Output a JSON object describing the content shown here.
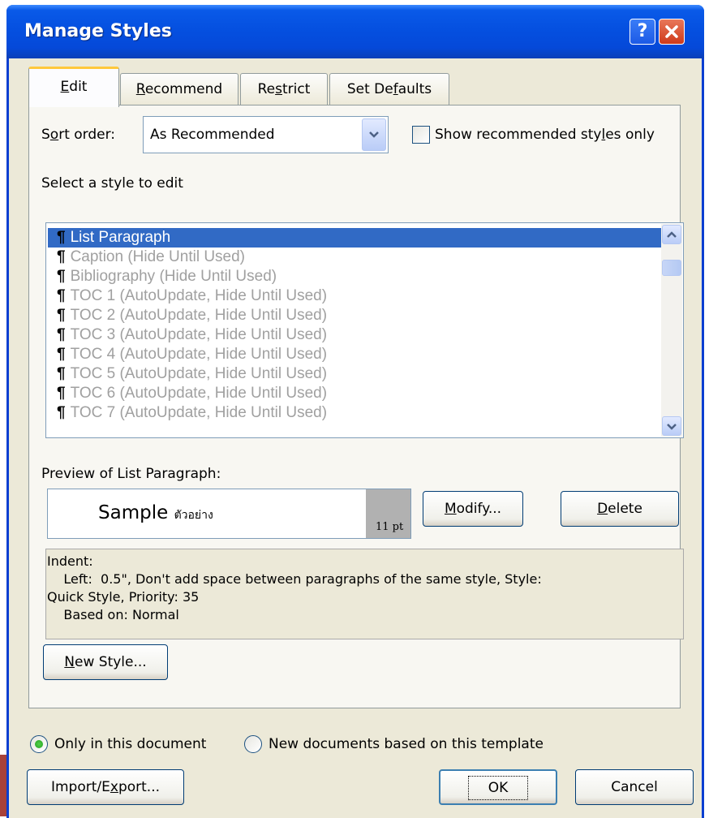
{
  "window": {
    "title": "Manage Styles",
    "help_icon": "?",
    "close_icon": "close"
  },
  "tabs": [
    {
      "pre": "",
      "u": "E",
      "post": "dit"
    },
    {
      "pre": "",
      "u": "R",
      "post": "ecommend"
    },
    {
      "pre": "Re",
      "u": "s",
      "post": "trict"
    },
    {
      "pre": "Set De",
      "u": "f",
      "post": "aults"
    }
  ],
  "sort": {
    "pre": "S",
    "u": "o",
    "post": "rt order:",
    "value": "As Recommended"
  },
  "show_recommended": {
    "pre": "Show recommended sty",
    "u": "l",
    "post": "es only",
    "checked": false
  },
  "select_label": "Select a style to edit",
  "styles": [
    {
      "name": "List Paragraph",
      "note": "",
      "selected": true
    },
    {
      "name": "Caption",
      "note": "(Hide Until Used)"
    },
    {
      "name": "Bibliography",
      "note": "(Hide Until Used)"
    },
    {
      "name": "TOC 1",
      "note": "(AutoUpdate, Hide Until Used)"
    },
    {
      "name": "TOC 2",
      "note": "(AutoUpdate, Hide Until Used)"
    },
    {
      "name": "TOC 3",
      "note": "(AutoUpdate, Hide Until Used)"
    },
    {
      "name": "TOC 4",
      "note": "(AutoUpdate, Hide Until Used)"
    },
    {
      "name": "TOC 5",
      "note": "(AutoUpdate, Hide Until Used)"
    },
    {
      "name": "TOC 6",
      "note": "(AutoUpdate, Hide Until Used)"
    },
    {
      "name": "TOC 7",
      "note": "(AutoUpdate, Hide Until Used)"
    }
  ],
  "preview": {
    "label": "Preview of List Paragraph:",
    "sample": "Sample",
    "sample_thai": "ตัวอย่าง",
    "size": "11 pt"
  },
  "buttons": {
    "modify": {
      "pre": "",
      "u": "M",
      "post": "odify..."
    },
    "delete": {
      "pre": "",
      "u": "D",
      "post": "elete"
    },
    "new_style": {
      "pre": "",
      "u": "N",
      "post": "ew Style..."
    },
    "import_export": {
      "pre": "Import/E",
      "u": "x",
      "post": "port..."
    },
    "ok": "OK",
    "cancel": "Cancel"
  },
  "description": {
    "line1": "Indent:",
    "line2": "    Left:  0.5\", Don't add space between paragraphs of the same style, Style:",
    "line3": "Quick Style, Priority: 35",
    "line4": "    Based on: Normal"
  },
  "scope": {
    "selected": "Only in this document",
    "options": [
      "Only in this document",
      "New documents based on this template"
    ]
  },
  "colors": {
    "selection": "#316ac5",
    "titlebar": "#0550e0",
    "dialog": "#ece9d8"
  }
}
